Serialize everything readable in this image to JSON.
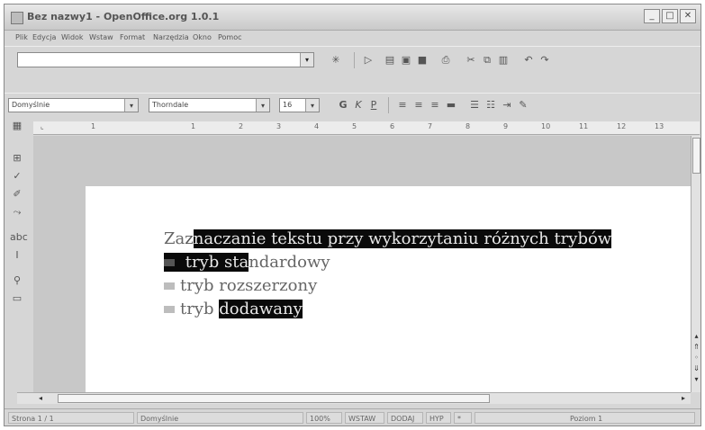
{
  "window": {
    "title": "Bez nazwy1 - OpenOffice.org 1.0.1",
    "minimize": "_",
    "maximize": "□",
    "close": "✕"
  },
  "menu": {
    "items": [
      "Plik",
      "Edycja",
      "Widok",
      "Wstaw",
      "Format",
      "Narzędzia",
      "Okno",
      "Pomoc"
    ]
  },
  "toolbar": {
    "url_value": ""
  },
  "format": {
    "style": "Domyślnie",
    "font": "Thorndale",
    "size": "16",
    "bold": "G",
    "italic": "K",
    "underline": "P"
  },
  "ruler": {
    "numbers": [
      "1",
      "1",
      "2",
      "3",
      "4",
      "5",
      "6",
      "7",
      "8",
      "9",
      "10",
      "11",
      "12",
      "13"
    ]
  },
  "document": {
    "line1": {
      "normal": "Za",
      "partial": "z",
      "selected": "naczanie tekstu przy wykorzytaniu różnych trybów"
    },
    "line2": {
      "selected": " tryb sta",
      "normal": "ndardowy"
    },
    "line3": {
      "normal": "tryb rozszerzony"
    },
    "line4": {
      "normal": "tryb ",
      "selected": "dodawany"
    }
  },
  "status": {
    "page": "Strona 1 / 1",
    "style": "Domyślnie",
    "zoom": "100%",
    "insert": "WSTAW",
    "add": "DODAJ",
    "hyp": "HYP",
    "star": "*",
    "level": "Poziom 1"
  }
}
